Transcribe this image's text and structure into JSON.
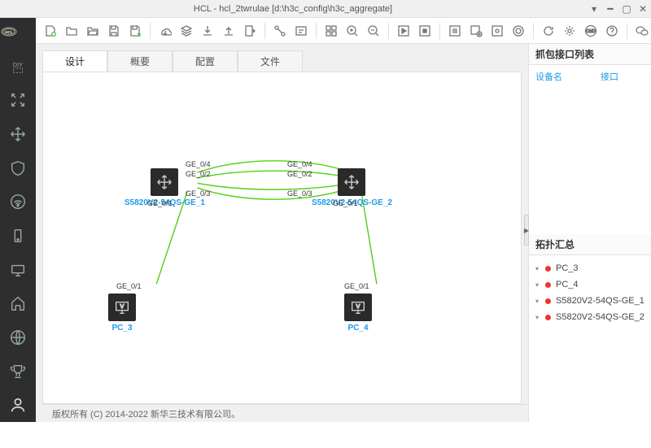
{
  "window": {
    "title": "HCL - hcl_2twrulae [d:\\h3c_config\\h3c_aggregate]"
  },
  "tabs": {
    "design": "设计",
    "overview": "概要",
    "config": "配置",
    "file": "文件"
  },
  "rightpanel": {
    "capture_title": "抓包接口列表",
    "device_col": "设备名",
    "iface_col": "接口",
    "topo_title": "拓扑汇总"
  },
  "nodes": {
    "sw1": "S5820V2-54QS-GE_1",
    "sw2": "S5820V2-54QS-GE_2",
    "pc3": "PC_3",
    "pc4": "PC_4"
  },
  "ports": {
    "g01_a": "GE_0/1",
    "g01_b": "GE_0/1",
    "g02_a": "GE_0/2",
    "g02_b": "GE_0/2",
    "g03_a": "GE_0/3",
    "g03_b": "GE_0/3",
    "g04_a": "GE_0/4",
    "g04_b": "GE_0/4",
    "g01_c": "GE_0/1",
    "g01_d": "GE_0/1"
  },
  "topo_items": [
    "PC_3",
    "PC_4",
    "S5820V2-54QS-GE_1",
    "S5820V2-54QS-GE_2"
  ],
  "footer": "版权所有 (C) 2014-2022 新华三技术有限公司。"
}
